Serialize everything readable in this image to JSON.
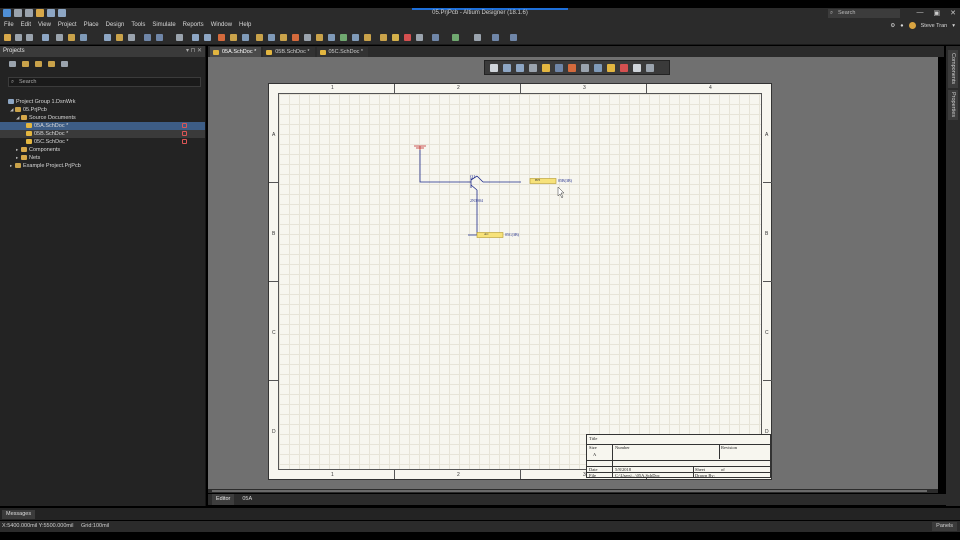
{
  "window": {
    "title": "05.PrjPcb - Altium Designer (18.1.6)",
    "search_placeholder": "Search",
    "controls": [
      "—",
      "▣",
      "✕"
    ]
  },
  "menu": {
    "items": [
      "File",
      "Edit",
      "View",
      "Project",
      "Place",
      "Design",
      "Tools",
      "Simulate",
      "Reports",
      "Window",
      "Help"
    ],
    "user_name": "Steve Tran"
  },
  "projects_panel": {
    "title": "Projects",
    "search_placeholder": "Search",
    "tree": [
      {
        "label": "Project Group 1.DsnWrk",
        "level": 0
      },
      {
        "label": "05.PrjPcb",
        "level": 1
      },
      {
        "label": "Source Documents",
        "level": 2
      },
      {
        "label": "05A.SchDoc *",
        "level": 3
      },
      {
        "label": "05B.SchDoc *",
        "level": 3
      },
      {
        "label": "05C.SchDoc *",
        "level": 3
      },
      {
        "label": "Components",
        "level": 2
      },
      {
        "label": "Nets",
        "level": 2
      },
      {
        "label": "Example Project.PrjPcb",
        "level": 0
      }
    ]
  },
  "doc_tabs": [
    "05A.SchDoc *",
    "05B.SchDoc *",
    "05C.SchDoc *"
  ],
  "schematic": {
    "zone_columns": [
      "1",
      "2",
      "3",
      "4"
    ],
    "zone_rows": [
      "A",
      "B",
      "C",
      "D"
    ],
    "components": {
      "transistor_designator": "Q1",
      "transistor_part": "2N3904",
      "port_top_name": "BH",
      "port_top_net": "05B(3B)",
      "port_bottom_name": "AC",
      "port_bottom_net": "05C(3B)"
    },
    "title_block": {
      "title_label": "Title",
      "size_label": "Size",
      "size_value": "A",
      "number_label": "Number",
      "revision_label": "Revision",
      "date_label": "Date",
      "date_value": "5/8/2018",
      "sheet_label": "Sheet",
      "sheet_value": "of",
      "file_label": "File",
      "file_value": "C:\\Users\\...\\05A.SchDoc",
      "drawn_label": "Drawn By:"
    }
  },
  "editor_bar": {
    "editor_label": "Editor",
    "doc_label": "05A"
  },
  "right_tabs": [
    "Components",
    "Properties"
  ],
  "messages_tab": "Messages",
  "status": {
    "coords": "X:5400.000mil Y:5500.000mil",
    "grid": "Grid:100mil",
    "panels_button": "Panels"
  }
}
